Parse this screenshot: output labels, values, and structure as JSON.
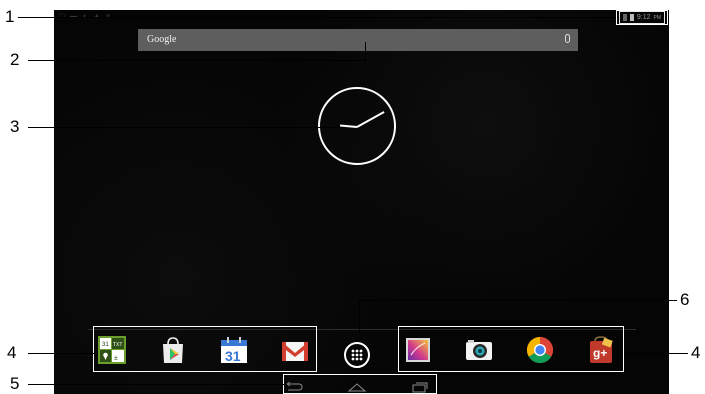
{
  "status_bar": {
    "notification_icons": "□ ▬ ◐ ▲ ≡",
    "time": "9:12",
    "ampm": "PM"
  },
  "search": {
    "label": "Google"
  },
  "favorites_left": [
    "office-suite-app-icon",
    "play-store-app-icon",
    "calendar-app-icon",
    "gmail-app-icon"
  ],
  "calendar_day": "31",
  "office_text": "TXT",
  "favorites_right": [
    "gallery-app-icon",
    "camera-app-icon",
    "chrome-app-icon",
    "google-plus-app-icon"
  ],
  "google_plus_text": "g+",
  "nav_buttons": [
    "back-button",
    "home-button",
    "recent-apps-button"
  ],
  "callouts": {
    "c1": "1",
    "c2": "2",
    "c3": "3",
    "c4_left": "4",
    "c4_right": "4",
    "c5": "5",
    "c6": "6"
  }
}
